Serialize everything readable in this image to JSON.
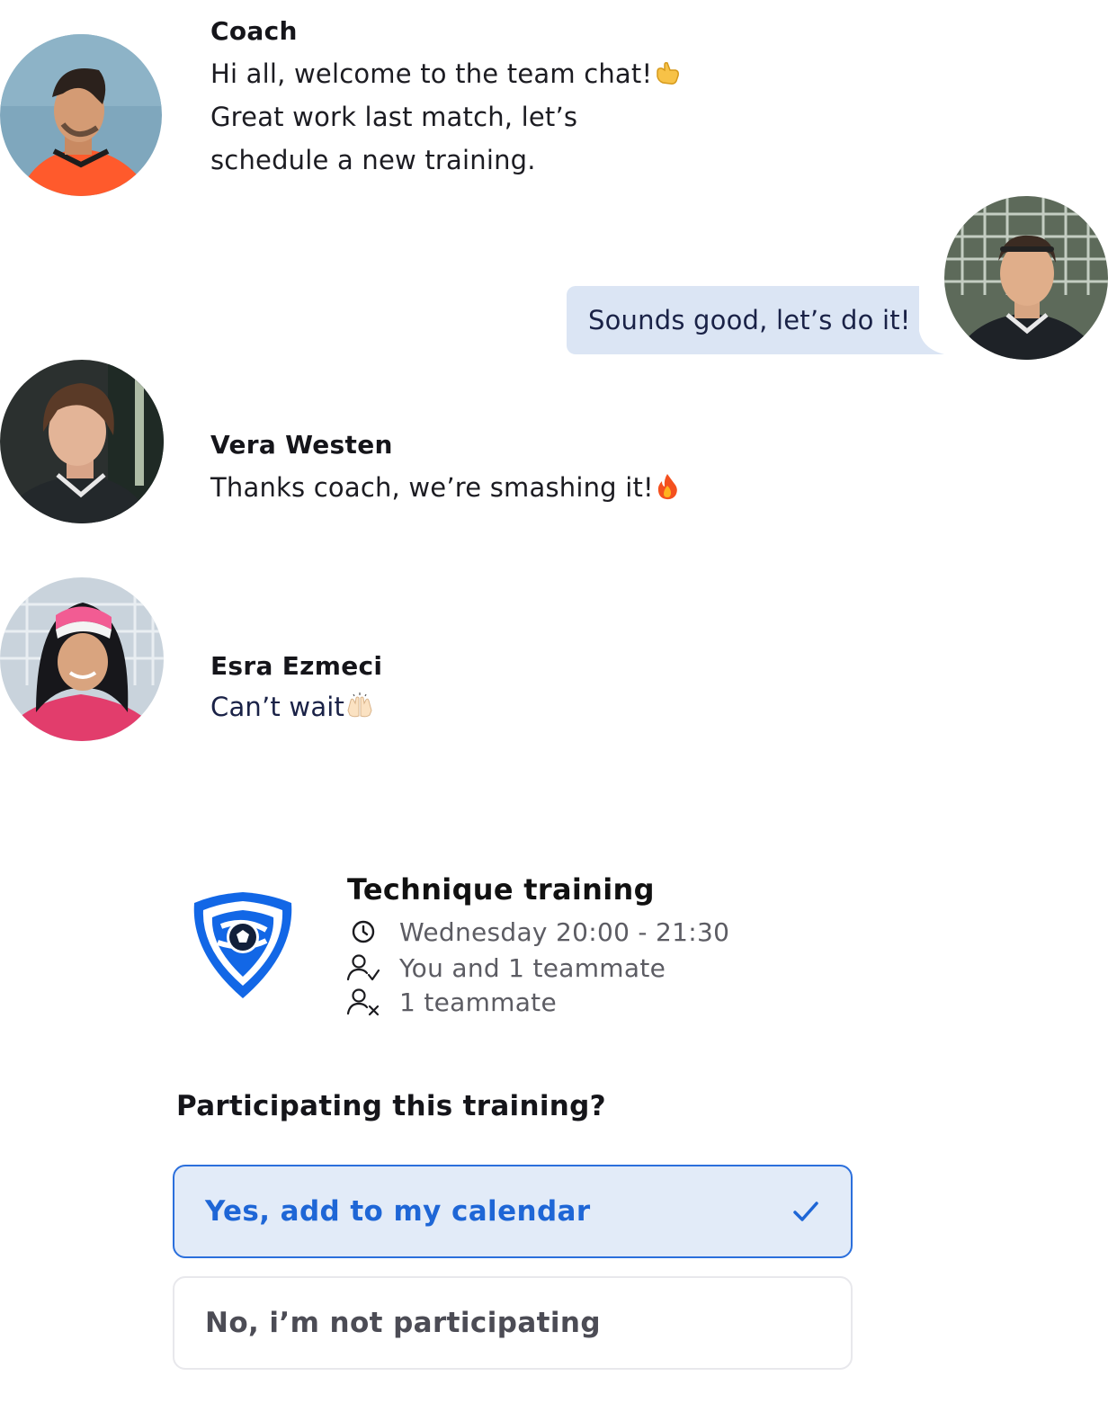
{
  "messages": [
    {
      "sender": "Coach",
      "lines": [
        "Hi all, welcome to the team chat!",
        "Great work last match, let’s",
        "schedule a new training."
      ],
      "emoji": "call-me-hand"
    },
    {
      "sender": "me",
      "text": "Sounds good, let’s do it!"
    },
    {
      "sender": "Vera Westen",
      "lines": [
        "Thanks coach, we’re smashing it!"
      ],
      "emoji": "fire"
    },
    {
      "sender": "Esra Ezmeci",
      "lines": [
        "Can’t wait"
      ],
      "emoji": "raising-hands"
    }
  ],
  "training": {
    "title": "Technique training",
    "time": "Wednesday 20:00 - 21:30",
    "attending": "You and 1 teammate",
    "not_attending": "1 teammate",
    "icon": "shield-football-logo"
  },
  "rsvp": {
    "question": "Participating this training?",
    "yes_label": "Yes, add to my calendar",
    "no_label": "No, i’m not participating",
    "selected": "yes"
  },
  "colors": {
    "accent": "#1e66d6",
    "bubble": "#dbe5f4",
    "selected_bg": "#e2ebf8"
  }
}
